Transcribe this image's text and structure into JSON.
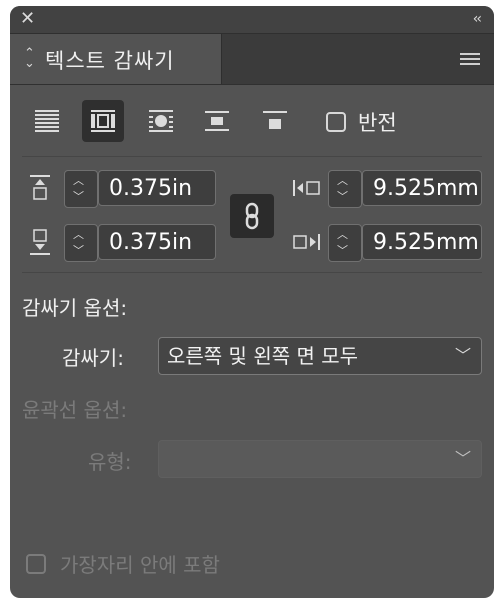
{
  "window": {
    "close_icon": "close-icon",
    "collapse_glyph": "‹‹"
  },
  "panel": {
    "tab_title": "텍스트 감싸기",
    "tab_chevron": "⌃⌄",
    "menu_icon": "hamburger-icon"
  },
  "wrap_options": {
    "buttons": [
      "no-wrap",
      "wrap-bounding-box",
      "wrap-object-shape",
      "jump-object",
      "jump-next-column"
    ],
    "selected": "wrap-bounding-box",
    "invert_label": "반전",
    "invert_checked": false
  },
  "offsets": {
    "top": "0.375in",
    "bottom": "0.375in",
    "left": "9.525mm",
    "right": "9.525mm",
    "linked": true
  },
  "wrap_section": {
    "title": "감싸기 옵션:",
    "wrap_label": "감싸기:",
    "wrap_value": "오른쪽 및 왼쪽 면 모두"
  },
  "contour_section": {
    "title": "윤곽선 옵션:",
    "type_label": "유형:",
    "type_value": ""
  },
  "inside_edges": {
    "label": "가장자리 안에 포함",
    "checked": false
  }
}
